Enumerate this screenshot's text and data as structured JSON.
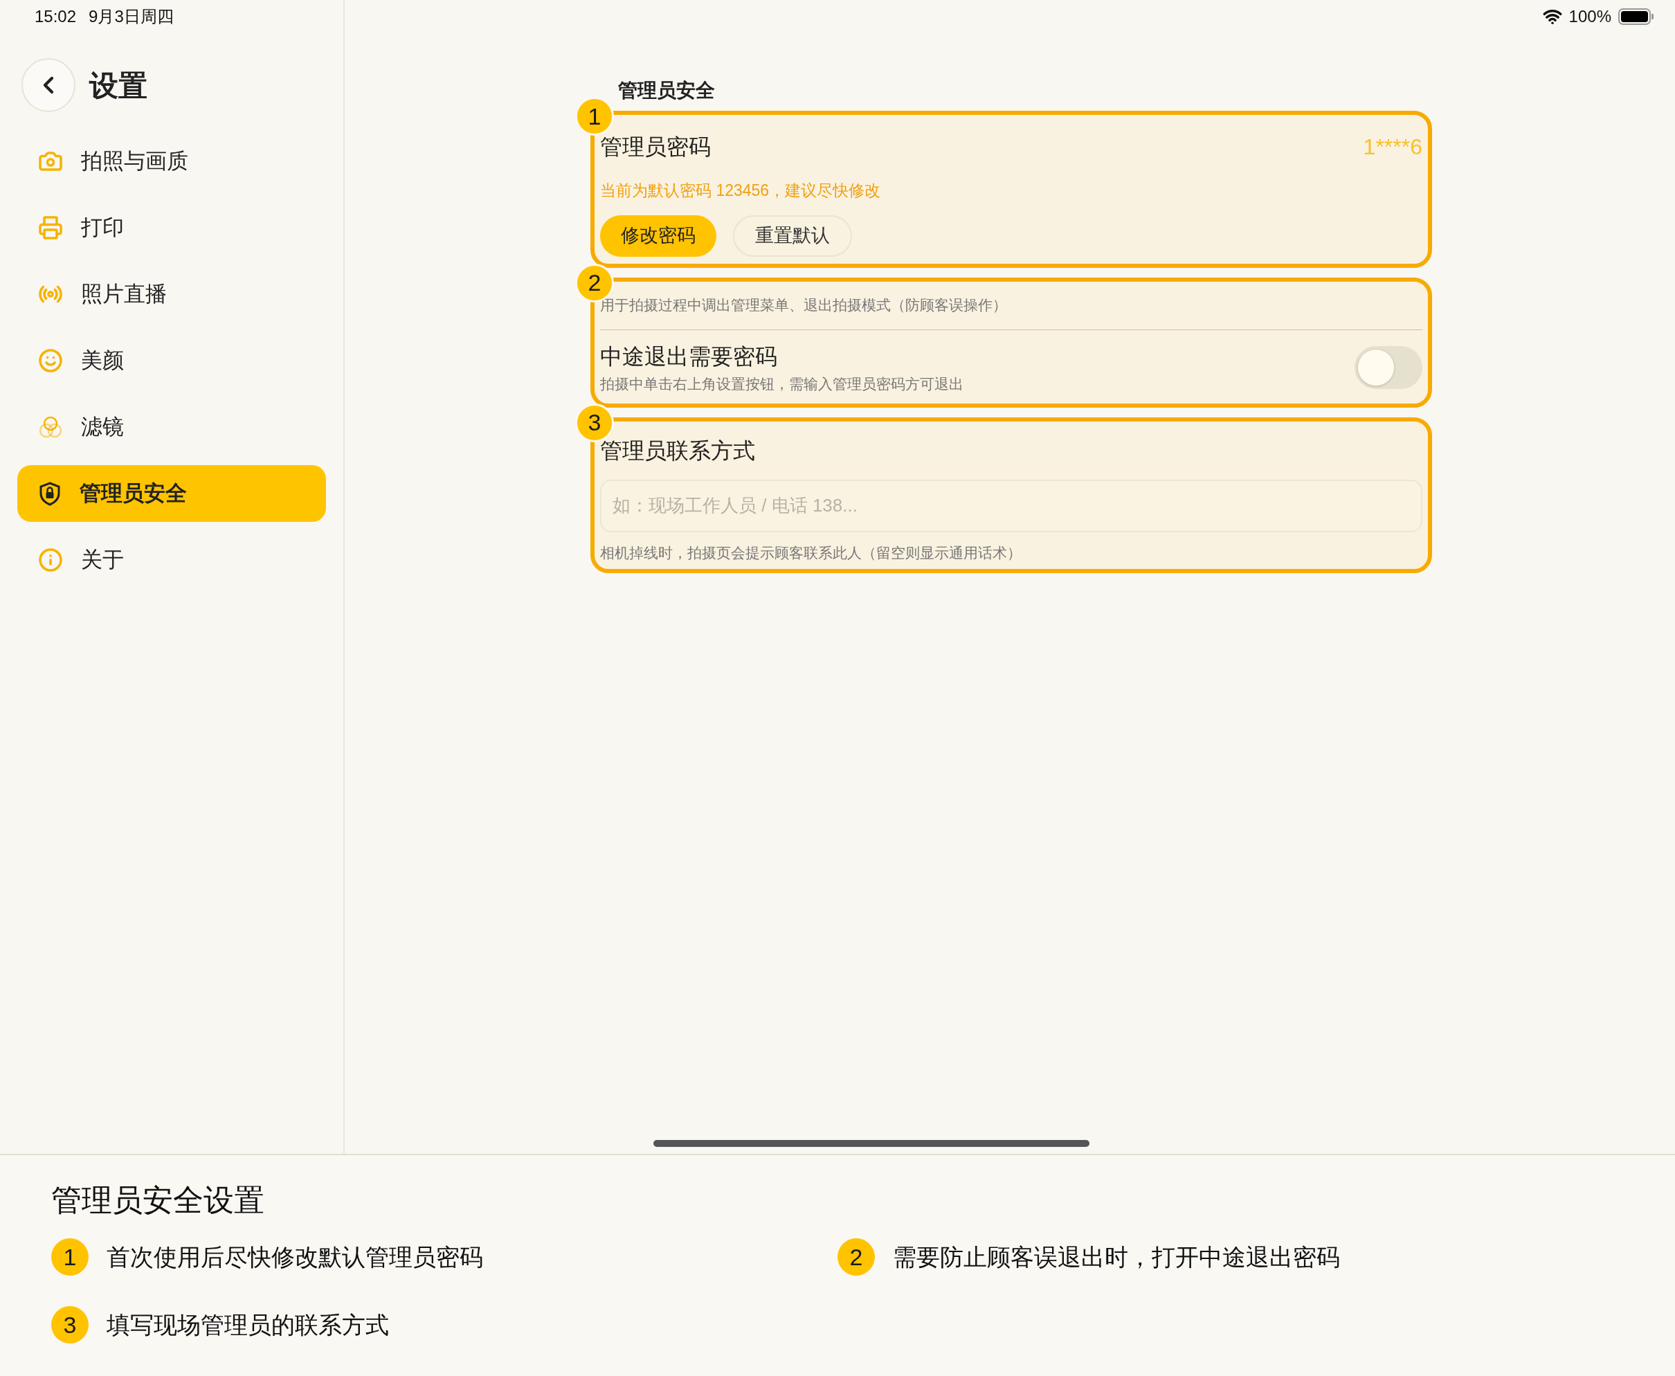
{
  "status_bar": {
    "time": "15:02",
    "date": "9月3日周四",
    "battery": "100%"
  },
  "sidebar": {
    "title": "设置",
    "items": [
      {
        "label": "拍照与画质",
        "selected": false
      },
      {
        "label": "打印",
        "selected": false
      },
      {
        "label": "照片直播",
        "selected": false
      },
      {
        "label": "美颜",
        "selected": false
      },
      {
        "label": "滤镜",
        "selected": false
      },
      {
        "label": "管理员安全",
        "selected": true
      },
      {
        "label": "关于",
        "selected": false
      }
    ]
  },
  "page": {
    "header": "管理员安全",
    "sections": [
      {
        "kind": "password",
        "callout": "1",
        "title": "管理员密码",
        "value": "1****6",
        "hint": "当前为默认密码 123456，建议尽快修改",
        "buttons": [
          {
            "label": "修改密码",
            "kind": "primary"
          },
          {
            "label": "重置默认",
            "kind": "secondary"
          }
        ]
      },
      {
        "kind": "toggle",
        "callout": "2",
        "caption": "用于拍摄过程中调出管理菜单、退出拍摄模式（防顾客误操作）",
        "title": "中途退出需要密码",
        "description": "拍摄中单击右上角设置按钮，需输入管理员密码方可退出",
        "on": false
      },
      {
        "kind": "contact",
        "callout": "3",
        "title": "管理员联系方式",
        "placeholder": "如：现场工作人员 / 电话 138...",
        "note": "相机掉线时，拍摄页会提示顾客联系此人（留空则显示通用话术）"
      }
    ]
  },
  "annotations": {
    "title": "管理员安全设置",
    "items": [
      {
        "number": "1",
        "text": "首次使用后尽快修改默认管理员密码"
      },
      {
        "number": "2",
        "text": "需要防止顾客误退出时，打开中途退出密码"
      },
      {
        "number": "3",
        "text": "填写现场管理员的联系方式"
      }
    ]
  }
}
